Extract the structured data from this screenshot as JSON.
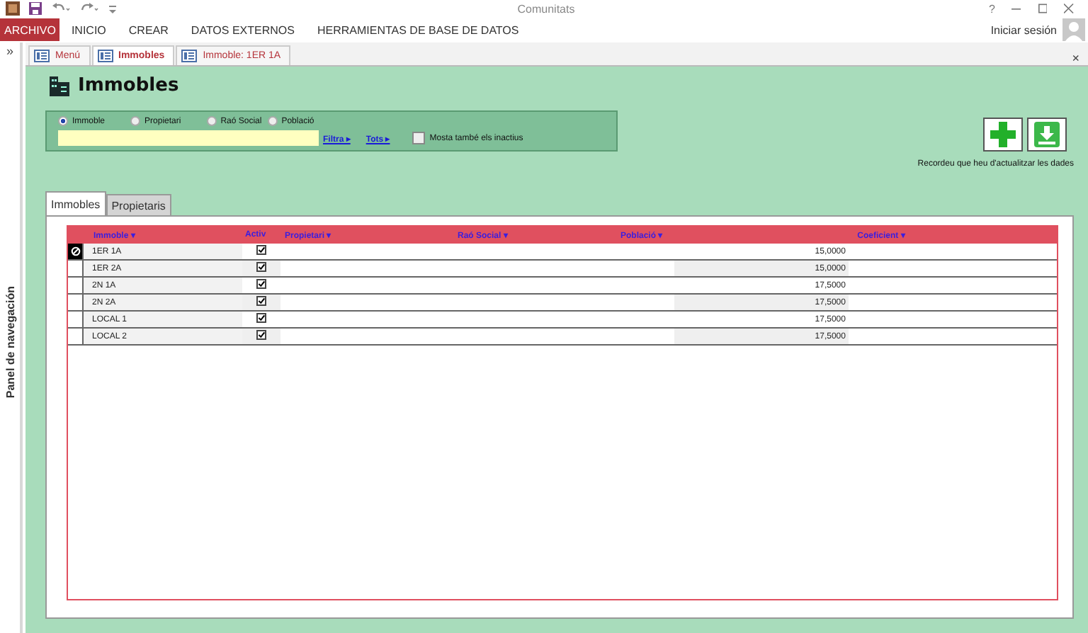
{
  "window": {
    "title": "Comunitats",
    "help": "?"
  },
  "ribbon_tabs": [
    {
      "label": "ARCHIVO",
      "kind": "file"
    },
    {
      "label": "INICIO",
      "kind": "tab"
    },
    {
      "label": "CREAR",
      "kind": "tab"
    },
    {
      "label": "DATOS EXTERNOS",
      "kind": "tab"
    },
    {
      "label": "HERRAMIENTAS DE BASE DE DATOS",
      "kind": "tab"
    }
  ],
  "account": "Iniciar sesión",
  "nav_panel": {
    "toggle": "»",
    "label": "Panel de navegación"
  },
  "doc_tabs": [
    {
      "label": "Menú",
      "selected": false
    },
    {
      "label": "Immobles",
      "selected": true
    },
    {
      "label": "Immoble: 1ER 1A",
      "selected": false
    }
  ],
  "doc_close": "×",
  "form": {
    "title": "Immobles",
    "search_by": [
      {
        "label": "Immoble",
        "selected": true
      },
      {
        "label": "Propietari",
        "selected": false
      },
      {
        "label": "Raó Social",
        "selected": false
      },
      {
        "label": "Població",
        "selected": false
      }
    ],
    "filter_link": "Filtra ▸",
    "all_link": "Tots ▸",
    "inactive": {
      "label": "Mosta també els inactius",
      "checked": false
    },
    "note": "Recordeu que heu d'actualitzar les dades",
    "subtabs": [
      {
        "label": "Immobles",
        "selected": true
      },
      {
        "label": "Propietaris",
        "selected": false
      }
    ],
    "table": {
      "columns": [
        "Immoble ▾",
        "Activ",
        "Propietari ▾",
        "Raó Social ▾",
        "Població ▾",
        "Coeficient ▾"
      ],
      "rows": [
        {
          "immoble": "1ER 1A",
          "actiu": true,
          "coeficient": "15,0000",
          "selected": true
        },
        {
          "immoble": "1ER 2A",
          "actiu": true,
          "coeficient": "15,0000",
          "selected": false
        },
        {
          "immoble": "2N 1A",
          "actiu": true,
          "coeficient": "17,5000",
          "selected": false
        },
        {
          "immoble": "2N 2A",
          "actiu": true,
          "coeficient": "17,5000",
          "selected": false
        },
        {
          "immoble": "LOCAL 1",
          "actiu": true,
          "coeficient": "17,5000",
          "selected": false
        },
        {
          "immoble": "LOCAL 2",
          "actiu": true,
          "coeficient": "17,5000",
          "selected": false
        }
      ]
    }
  }
}
